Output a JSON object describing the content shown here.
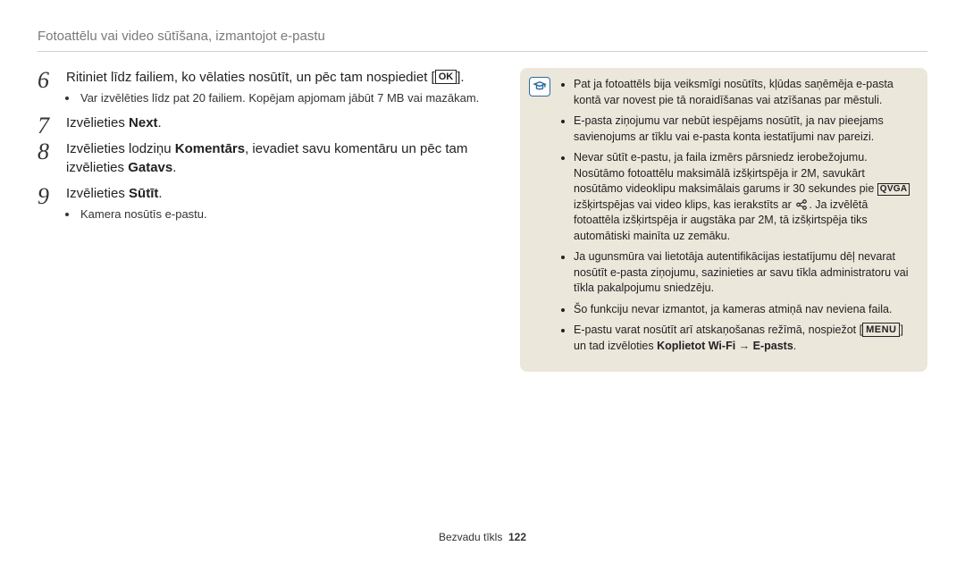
{
  "header": "Fotoattēlu vai video sūtīšana, izmantojot e-pastu",
  "steps": {
    "s6": {
      "num": "6",
      "text_before": "Ritiniet līdz failiem, ko vēlaties nosūtīt, un pēc tam nospiediet [",
      "text_after": "].",
      "bullet": "Var izvēlēties līdz pat 20 failiem. Kopējam apjomam jābūt 7 MB vai mazākam."
    },
    "s7": {
      "num": "7",
      "text_a": "Izvēlieties ",
      "bold_a": "Next",
      "text_b": "."
    },
    "s8": {
      "num": "8",
      "text_a": "Izvēlieties lodziņu ",
      "bold_a": "Komentārs",
      "text_b": ", ievadiet savu komentāru un pēc tam izvēlieties ",
      "bold_b": "Gatavs",
      "text_c": "."
    },
    "s9": {
      "num": "9",
      "text_a": "Izvēlieties ",
      "bold_a": "Sūtīt",
      "text_b": ".",
      "bullet": "Kamera nosūtīs e-pastu."
    }
  },
  "notes": {
    "n1": "Pat ja fotoattēls bija veiksmīgi nosūtīts, kļūdas saņēmēja e-pasta kontā var novest pie tā noraidīšanas vai atzīšanas par mēstuli.",
    "n2": "E-pasta ziņojumu var nebūt iespējams nosūtīt, ja nav pieejams savienojums ar tīklu vai e-pasta konta iestatījumi nav pareizi.",
    "n3a": "Nevar sūtīt e-pastu, ja faila izmērs pārsniedz ierobežojumu. Nosūtāmo fotoattēlu maksimālā izšķirtspēja ir 2M, savukārt nosūtāmo videoklipu maksimālais garums ir 30 sekundes pie ",
    "n3b": " izšķirtspējas vai video klips, kas ierakstīts ar ",
    "n3c": ". Ja izvēlētā fotoattēla izšķirtspēja ir augstāka par 2M, tā izšķirtspēja tiks automātiski mainīta uz zemāku.",
    "n4": "Ja ugunsmūra vai lietotāja autentifikācijas iestatījumu dēļ nevarat nosūtīt e-pasta ziņojumu, sazinieties ar savu tīkla administratoru vai tīkla pakalpojumu sniedzēju.",
    "n5": "Šo funkciju nevar izmantot, ja kameras atmiņā nav neviena faila.",
    "n6a": "E-pastu varat nosūtīt arī atskaņošanas režīmā, nospiežot [",
    "n6b": "] un tad izvēloties ",
    "n6bold": "Koplietot Wi-Fi → E-pasts",
    "n6c": ".",
    "qvga": "QVGA",
    "menu": "MENU",
    "ok": "OK"
  },
  "footer": {
    "section": "Bezvadu tīkls",
    "page": "122"
  }
}
